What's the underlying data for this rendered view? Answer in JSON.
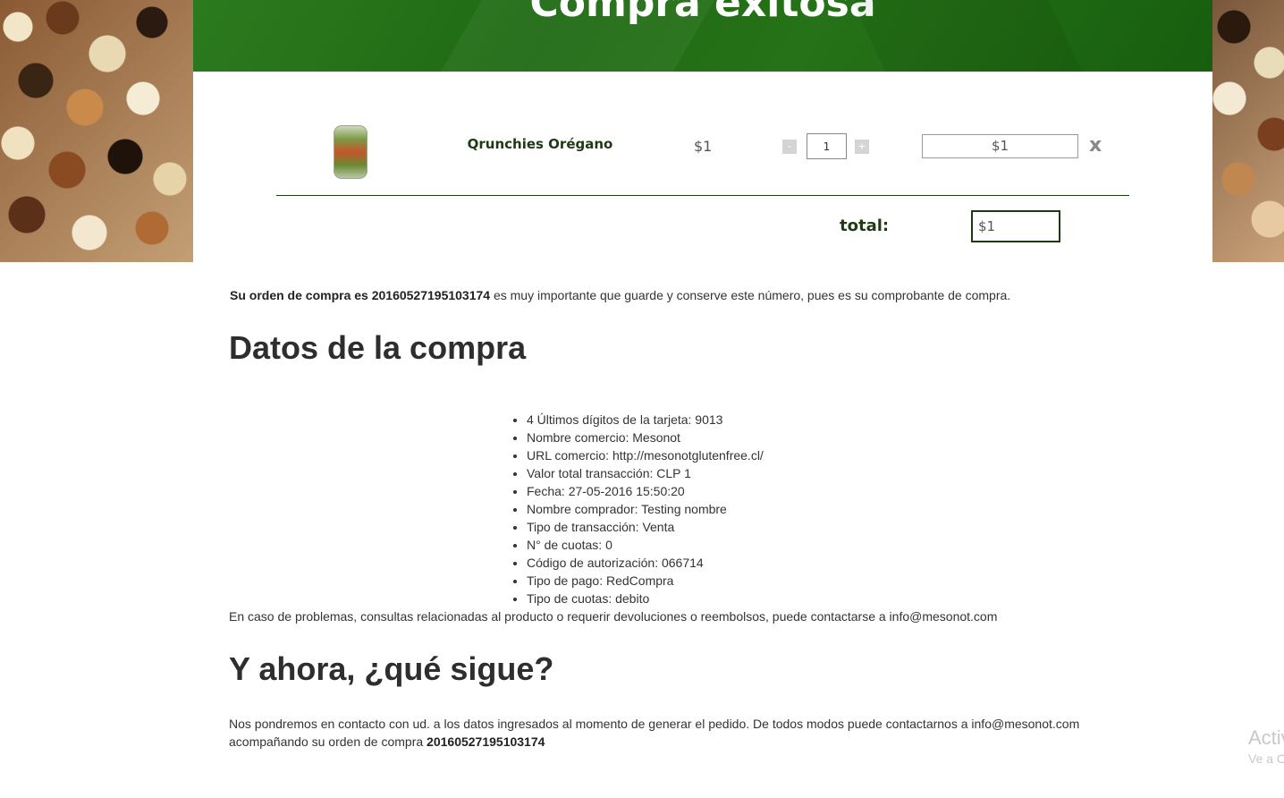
{
  "banner": {
    "title": "Compra exitosa"
  },
  "cart": {
    "product_name": "Qrunchies Orégano",
    "unit_price": "$1",
    "qty_minus": "-",
    "quantity": "1",
    "qty_plus": "+",
    "subtotal": "$1",
    "remove": "x",
    "total_label": "total:",
    "total_value": "$1"
  },
  "order": {
    "prefix": "Su orden de compra es 20160527195103174",
    "suffix": " es muy importante que guarde y conserve este número, pues es su comprobante de compra."
  },
  "datos": {
    "heading": "Datos de la compra",
    "items": [
      "4 Últimos dígitos de la tarjeta: 9013",
      "Nombre comercio: Mesonot",
      "URL comercio: http://mesonotglutenfree.cl/",
      "Valor total transacción: CLP 1",
      "Fecha: 27-05-2016 15:50:20",
      "Nombre comprador: Testing nombre",
      "Tipo de transacción: Venta",
      "N° de cuotas: 0",
      "Código de autorización: 066714",
      "Tipo de pago: RedCompra",
      "Tipo de cuotas: debito"
    ],
    "problems": "En caso de problemas, consultas relacionadas al producto o requerir devoluciones o reembolsos, puede contactarse a info@mesonot.com"
  },
  "next": {
    "heading": "Y ahora, ¿qué sigue?",
    "text": "Nos pondremos en contacto con ud. a los datos ingresados al momento de generar el pedido. De todos modos puede contactarnos a info@mesonot.com acompañando su orden de compra ",
    "order_number": "20160527195103174"
  },
  "watermark": {
    "title": "Activ",
    "subtitle": "Ve a C"
  }
}
